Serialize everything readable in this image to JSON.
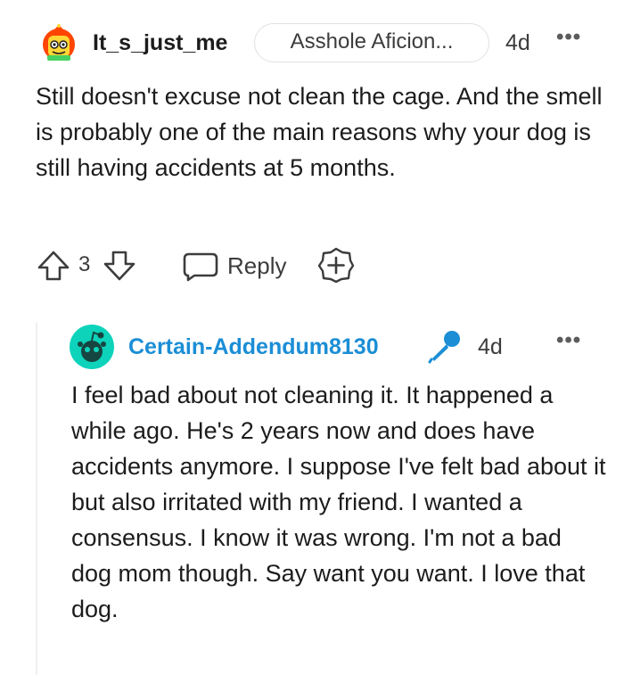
{
  "comment": {
    "username": "It_s_just_me",
    "flair": "Asshole Aficion...",
    "time": "4d",
    "more": "•••",
    "body": "Still doesn't excuse not clean the cage. And the smell is probably one of the main reasons why your dog is still having accidents at 5 months.",
    "vote_count": "3",
    "reply_label": "Reply",
    "icons": {
      "avatar": "user-avatar-icon",
      "upvote": "upvote-icon",
      "downvote": "downvote-icon",
      "reply": "reply-bubble-icon",
      "award": "award-plus-icon",
      "more": "more-options-icon"
    }
  },
  "reply": {
    "username": "Certain-Addendum8130",
    "time": "4d",
    "more": "•••",
    "body": "I feel bad about not cleaning it. It happened a while ago. He's 2 years now and does have accidents anymore. I suppose I've felt bad about it but also irritated with my friend. I wanted a consensus. I know it was wrong. I'm not a bad dog mom though. Say want you want. I love that dog.",
    "icons": {
      "avatar": "snoo-avatar-icon",
      "op_badge": "microphone-icon",
      "more": "more-options-icon"
    }
  },
  "colors": {
    "text": "#1c1c1c",
    "secondary": "#3c3c3c",
    "reply_username": "#1b8ed6",
    "avatar_teal": "#0dd3bb",
    "thread_line": "#edeff1",
    "flair_border": "#dfe1e4"
  }
}
